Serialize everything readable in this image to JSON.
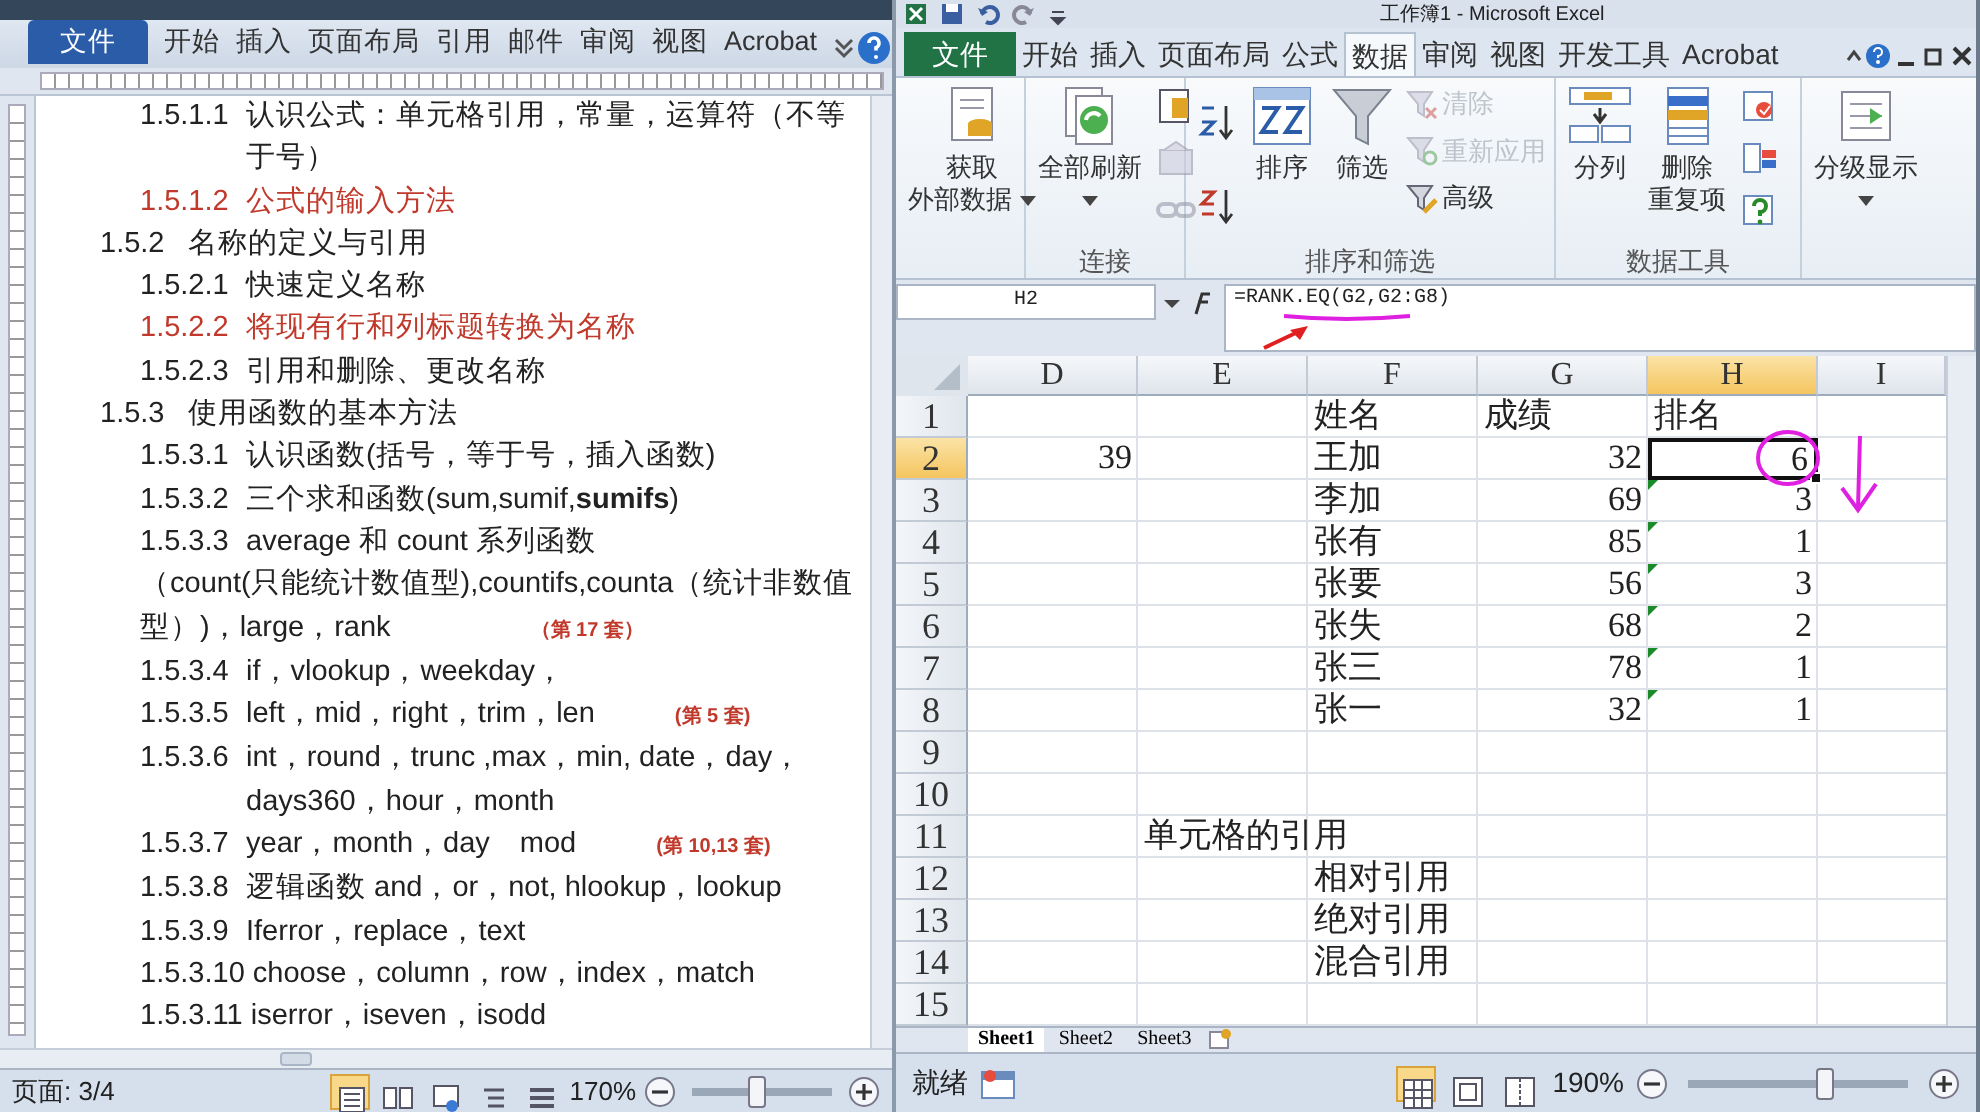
{
  "word": {
    "tabs": [
      {
        "label": "文件",
        "kind": "file"
      },
      {
        "label": "开始",
        "kind": "tab"
      },
      {
        "label": "插入",
        "kind": "tab"
      },
      {
        "label": "页面布局",
        "kind": "tab"
      },
      {
        "label": "引用",
        "kind": "tab"
      },
      {
        "label": "邮件",
        "kind": "tab"
      },
      {
        "label": "审阅",
        "kind": "tab"
      },
      {
        "label": "视图",
        "kind": "tab"
      },
      {
        "label": "Acrobat",
        "kind": "tab"
      }
    ],
    "outline": {
      "continued": [
        {
          "kind": "entry",
          "number": "1.5.1.1",
          "text": "认识公式：单元格引用，常量，运算符（不等于号）",
          "color": "#222222"
        },
        {
          "kind": "entry",
          "number": "1.5.1.2",
          "text": "公式的输入方法",
          "color": "#c0392b"
        }
      ],
      "sections": [
        {
          "number": "1.5.2",
          "text": "名称的定义与引用",
          "children": [
            {
              "kind": "entry",
              "number": "1.5.2.1",
              "text": "快速定义名称",
              "color": "#222222"
            },
            {
              "kind": "entry",
              "number": "1.5.2.2",
              "text": "将现有行和列标题转换为名称",
              "color": "#c0392b"
            },
            {
              "kind": "entry",
              "number": "1.5.2.3",
              "text": "引用和删除、更改名称",
              "color": "#222222"
            }
          ]
        },
        {
          "number": "1.5.3",
          "text": "使用函数的基本方法",
          "children": [
            {
              "kind": "entry",
              "number": "1.5.3.1",
              "text": "认识函数(括号，等于号，插入函数)",
              "color": "#222222"
            },
            {
              "kind": "entry",
              "number": "1.5.3.2",
              "text": "三个求和函数(sum,sumif,**sumifs**)",
              "color": "#222222"
            },
            {
              "kind": "entry",
              "number": "1.5.3.3",
              "text": "average 和 count 系列函数",
              "color": "#222222"
            },
            {
              "kind": "para",
              "text": "（count(只能统计数值型),countifs,counta（统计非数值型）)，large，rank",
              "note": "（第 17 套）",
              "color": "#222222"
            },
            {
              "kind": "entry",
              "number": "1.5.3.4",
              "text": "if，vlookup，weekday，",
              "color": "#222222"
            },
            {
              "kind": "entry",
              "number": "1.5.3.5",
              "text": "left，mid，right，trim，len",
              "note": "(第 5 套)",
              "color": "#222222"
            },
            {
              "kind": "entry",
              "number": "1.5.3.6",
              "text": "int，round，trunc ,max，min, date，day，days360，hour，month",
              "color": "#222222"
            },
            {
              "kind": "entry",
              "number": "1.5.3.7",
              "text": "year，month，day　mod",
              "note": "(第 10,13 套)",
              "color": "#222222"
            },
            {
              "kind": "entry",
              "number": "1.5.3.8",
              "text": "逻辑函数 and，or，not, hlookup，lookup",
              "color": "#222222"
            },
            {
              "kind": "entry",
              "number": "1.5.3.9",
              "text": "Iferror，replace，text",
              "color": "#222222"
            },
            {
              "kind": "entry",
              "number": "1.5.3.10",
              "text": "choose，column，row，index，match",
              "color": "#222222"
            },
            {
              "kind": "entry",
              "number": "1.5.3.11",
              "text": "iserror，iseven，isodd",
              "color": "#222222"
            }
          ]
        }
      ]
    },
    "status": {
      "page": "页面: 3/4",
      "views": [
        {
          "selected": true
        },
        {
          "selected": false
        },
        {
          "selected": false
        },
        {
          "selected": false
        },
        {
          "selected": false
        }
      ],
      "zoom": "170%",
      "zoom_slider": {
        "level": 0.45
      }
    }
  },
  "excel": {
    "title": "工作簿1 - Microsoft Excel",
    "tabs": [
      {
        "label": "文件",
        "kind": "file",
        "selected": false
      },
      {
        "label": "开始",
        "kind": "tab",
        "selected": false
      },
      {
        "label": "插入",
        "kind": "tab",
        "selected": false
      },
      {
        "label": "页面布局",
        "kind": "tab",
        "selected": false
      },
      {
        "label": "公式",
        "kind": "tab",
        "selected": false
      },
      {
        "label": "数据",
        "kind": "tab",
        "selected": true
      },
      {
        "label": "审阅",
        "kind": "tab",
        "selected": false
      },
      {
        "label": "视图",
        "kind": "tab",
        "selected": false
      },
      {
        "label": "开发工具",
        "kind": "tab",
        "selected": false
      },
      {
        "label": "Acrobat",
        "kind": "tab",
        "selected": false
      }
    ],
    "ribbon": {
      "groups": [
        {
          "columns": [
            [
              {
                "kind": "large",
                "lines": [
                  "获取",
                  "外部数据"
                ],
                "dropdown": true,
                "disabled": false
              }
            ]
          ]
        },
        {
          "label": "连接",
          "columns": [
            [
              {
                "kind": "large",
                "lines": [
                  "全部刷新"
                ],
                "dropdown": true,
                "disabled": false
              }
            ],
            [
              {
                "kind": "icon",
                "disabled": false
              },
              {
                "kind": "icon",
                "disabled": true
              },
              {
                "kind": "icon",
                "disabled": true
              }
            ]
          ]
        },
        {
          "label": "排序和筛选",
          "columns": [
            [
              {
                "kind": "icon",
                "disabled": false
              },
              {
                "kind": "icon",
                "disabled": false
              }
            ],
            [
              {
                "kind": "large",
                "lines": [
                  "排序"
                ],
                "dropdown": false,
                "disabled": false
              }
            ],
            [
              {
                "kind": "large",
                "lines": [
                  "筛选"
                ],
                "dropdown": false,
                "disabled": false
              }
            ],
            [
              {
                "kind": "small",
                "label": "清除",
                "disabled": true
              },
              {
                "kind": "small",
                "label": "重新应用",
                "disabled": true
              },
              {
                "kind": "small",
                "label": "高级",
                "disabled": false
              }
            ]
          ]
        },
        {
          "label": "数据工具",
          "columns": [
            [
              {
                "kind": "large",
                "lines": [
                  "分列"
                ],
                "dropdown": false,
                "disabled": false
              }
            ],
            [
              {
                "kind": "large",
                "lines": [
                  "删除",
                  "重复项"
                ],
                "dropdown": false,
                "disabled": false
              }
            ],
            [
              {
                "kind": "icon",
                "disabled": false
              },
              {
                "kind": "icon",
                "disabled": false
              },
              {
                "kind": "icon",
                "disabled": false
              }
            ]
          ]
        },
        {
          "columns": [
            [
              {
                "kind": "large",
                "lines": [
                  "分级显示"
                ],
                "dropdown": true,
                "disabled": false
              }
            ]
          ]
        }
      ]
    },
    "name_box": "H2",
    "formula": "=RANK.EQ(G2,G2:G8)",
    "columns": [
      {
        "label": "D",
        "selected": false
      },
      {
        "label": "E",
        "selected": false
      },
      {
        "label": "F",
        "selected": false
      },
      {
        "label": "G",
        "selected": false
      },
      {
        "label": "H",
        "selected": true
      },
      {
        "label": "I",
        "selected": false
      }
    ],
    "rows": [
      {
        "label": "1",
        "selected": false,
        "cells": [
          {
            "kind": "empty"
          },
          {
            "kind": "empty"
          },
          {
            "kind": "text",
            "text": "姓名"
          },
          {
            "kind": "text",
            "text": "成绩"
          },
          {
            "kind": "text",
            "text": "排名"
          },
          {
            "kind": "empty"
          }
        ]
      },
      {
        "label": "2",
        "selected": true,
        "cells": [
          {
            "kind": "number",
            "text": "39"
          },
          {
            "kind": "empty"
          },
          {
            "kind": "text",
            "text": "王加"
          },
          {
            "kind": "number",
            "text": "32"
          },
          {
            "kind": "number",
            "text": "6",
            "active": true
          },
          {
            "kind": "empty"
          }
        ]
      },
      {
        "label": "3",
        "selected": false,
        "cells": [
          {
            "kind": "empty"
          },
          {
            "kind": "empty"
          },
          {
            "kind": "text",
            "text": "李加"
          },
          {
            "kind": "number",
            "text": "69"
          },
          {
            "kind": "number",
            "text": "3",
            "flag": true
          },
          {
            "kind": "empty"
          }
        ]
      },
      {
        "label": "4",
        "selected": false,
        "cells": [
          {
            "kind": "empty"
          },
          {
            "kind": "empty"
          },
          {
            "kind": "text",
            "text": "张有"
          },
          {
            "kind": "number",
            "text": "85"
          },
          {
            "kind": "number",
            "text": "1",
            "flag": true
          },
          {
            "kind": "empty"
          }
        ]
      },
      {
        "label": "5",
        "selected": false,
        "cells": [
          {
            "kind": "empty"
          },
          {
            "kind": "empty"
          },
          {
            "kind": "text",
            "text": "张要"
          },
          {
            "kind": "number",
            "text": "56"
          },
          {
            "kind": "number",
            "text": "3",
            "flag": true
          },
          {
            "kind": "empty"
          }
        ]
      },
      {
        "label": "6",
        "selected": false,
        "cells": [
          {
            "kind": "empty"
          },
          {
            "kind": "empty"
          },
          {
            "kind": "text",
            "text": "张失"
          },
          {
            "kind": "number",
            "text": "68"
          },
          {
            "kind": "number",
            "text": "2",
            "flag": true
          },
          {
            "kind": "empty"
          }
        ]
      },
      {
        "label": "7",
        "selected": false,
        "cells": [
          {
            "kind": "empty"
          },
          {
            "kind": "empty"
          },
          {
            "kind": "text",
            "text": "张三"
          },
          {
            "kind": "number",
            "text": "78"
          },
          {
            "kind": "number",
            "text": "1",
            "flag": true
          },
          {
            "kind": "empty"
          }
        ]
      },
      {
        "label": "8",
        "selected": false,
        "cells": [
          {
            "kind": "empty"
          },
          {
            "kind": "empty"
          },
          {
            "kind": "text",
            "text": "张一"
          },
          {
            "kind": "number",
            "text": "32"
          },
          {
            "kind": "number",
            "text": "1",
            "flag": true
          },
          {
            "kind": "empty"
          }
        ]
      },
      {
        "label": "9",
        "selected": false,
        "cells": [
          {
            "kind": "empty"
          },
          {
            "kind": "empty"
          },
          {
            "kind": "empty"
          },
          {
            "kind": "empty"
          },
          {
            "kind": "empty"
          },
          {
            "kind": "empty"
          }
        ]
      },
      {
        "label": "10",
        "selected": false,
        "cells": [
          {
            "kind": "empty"
          },
          {
            "kind": "empty"
          },
          {
            "kind": "empty"
          },
          {
            "kind": "empty"
          },
          {
            "kind": "empty"
          },
          {
            "kind": "empty"
          }
        ]
      },
      {
        "label": "11",
        "selected": false,
        "cells": [
          {
            "kind": "empty"
          },
          {
            "kind": "text",
            "text": "单元格的引用"
          },
          {
            "kind": "empty"
          },
          {
            "kind": "empty"
          },
          {
            "kind": "empty"
          },
          {
            "kind": "empty"
          }
        ]
      },
      {
        "label": "12",
        "selected": false,
        "cells": [
          {
            "kind": "empty"
          },
          {
            "kind": "empty"
          },
          {
            "kind": "text",
            "text": "相对引用"
          },
          {
            "kind": "empty"
          },
          {
            "kind": "empty"
          },
          {
            "kind": "empty"
          }
        ]
      },
      {
        "label": "13",
        "selected": false,
        "cells": [
          {
            "kind": "empty"
          },
          {
            "kind": "empty"
          },
          {
            "kind": "text",
            "text": "绝对引用"
          },
          {
            "kind": "empty"
          },
          {
            "kind": "empty"
          },
          {
            "kind": "empty"
          }
        ]
      },
      {
        "label": "14",
        "selected": false,
        "cells": [
          {
            "kind": "empty"
          },
          {
            "kind": "empty"
          },
          {
            "kind": "text",
            "text": "混合引用"
          },
          {
            "kind": "empty"
          },
          {
            "kind": "empty"
          },
          {
            "kind": "empty"
          }
        ]
      },
      {
        "label": "15",
        "selected": false,
        "cells": [
          {
            "kind": "empty"
          },
          {
            "kind": "empty"
          },
          {
            "kind": "empty"
          },
          {
            "kind": "empty"
          },
          {
            "kind": "empty"
          },
          {
            "kind": "empty"
          }
        ]
      }
    ],
    "sheets": [
      {
        "label": "Sheet1",
        "selected": true
      },
      {
        "label": "Sheet2",
        "selected": false
      },
      {
        "label": "Sheet3",
        "selected": false
      }
    ],
    "status": {
      "text": "就绪",
      "views": [
        {
          "selected": true
        },
        {
          "selected": false
        },
        {
          "selected": false
        }
      ],
      "zoom": "190%",
      "zoom_slider": {
        "level": 0.62
      }
    }
  }
}
